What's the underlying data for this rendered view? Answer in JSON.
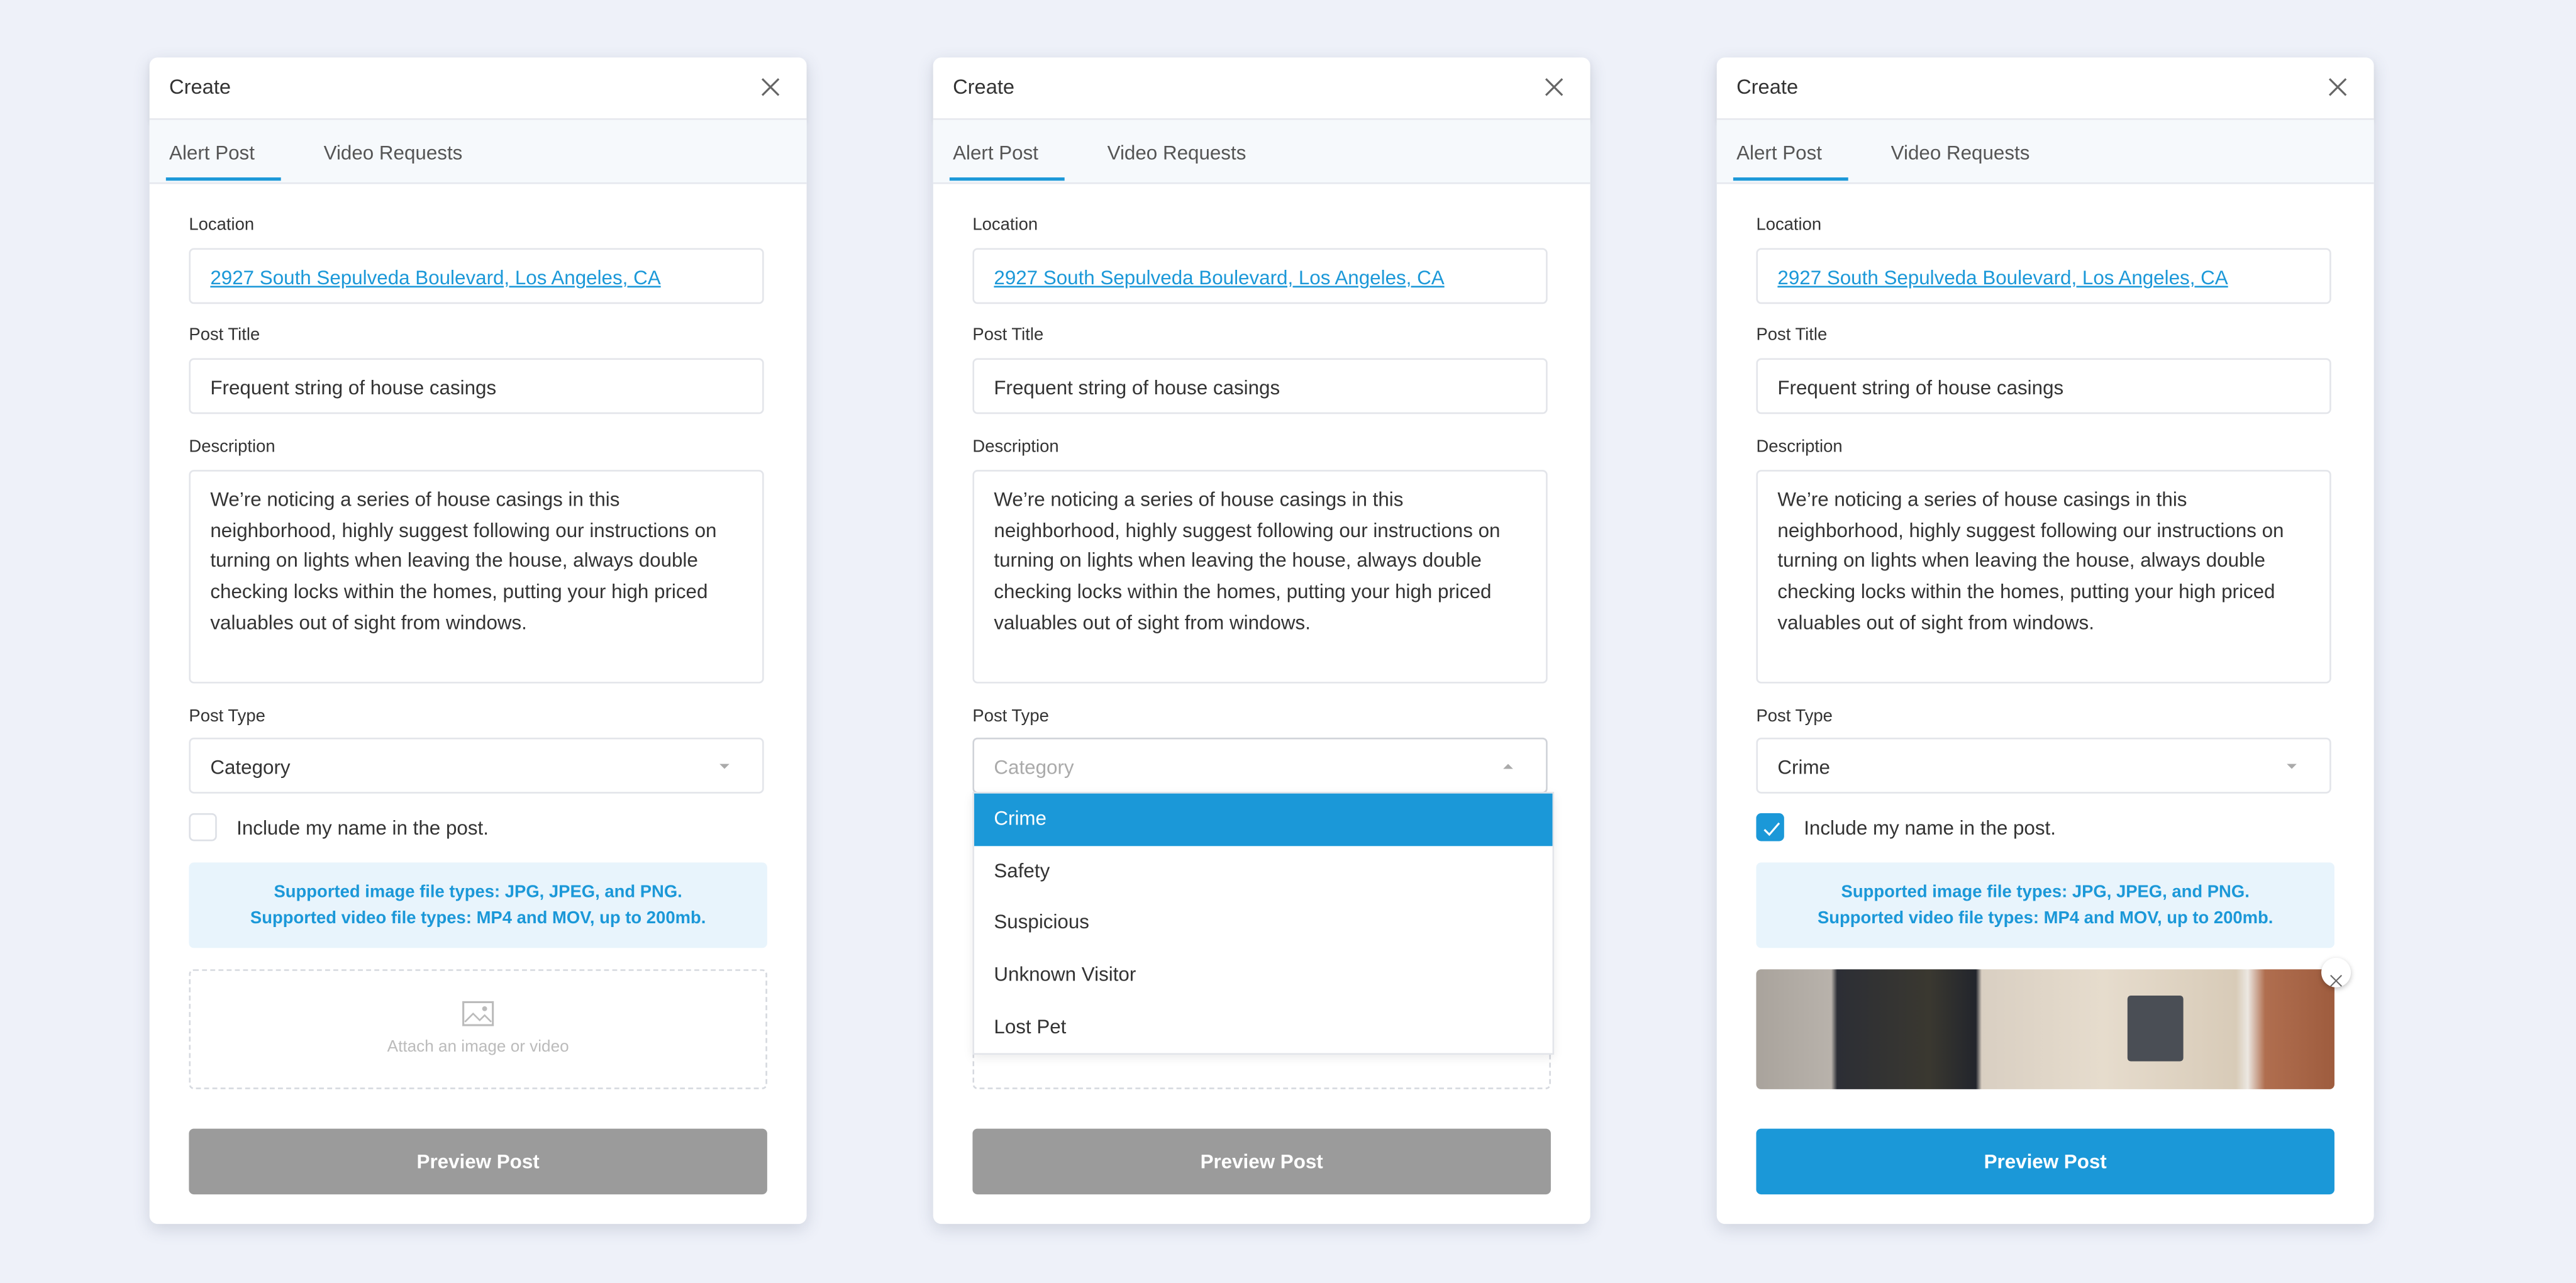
{
  "colors": {
    "accent": "#1b98d8",
    "disabled_button": "#9b9b9b",
    "background": "#eef1f9"
  },
  "dialogs": [
    {
      "title": "Create",
      "tabs": [
        "Alert Post",
        "Video Requests"
      ],
      "location_label": "Location",
      "location": "2927 South Sepulveda Boulevard, Los Angeles, CA",
      "title_label": "Post Title",
      "post_title": "Frequent string of house casings",
      "description_label": "Description",
      "description": "We’re noticing a series of house casings in this neighborhood, highly suggest following our instructions on turning on lights when leaving the house, always double checking locks within the homes, putting your high priced valuables out of sight from windows.",
      "type_label": "Post Type",
      "type_value": "Category",
      "include_name": "Include my name in the post.",
      "include_checked": false,
      "info_line1": "Supported image file types: JPG, JPEG, and PNG.",
      "info_line2": "Supported video file types: MP4 and MOV, up to 200mb.",
      "attach_label": "Attach an image or video",
      "preview": "Preview Post"
    },
    {
      "title": "Create",
      "tabs": [
        "Alert Post",
        "Video Requests"
      ],
      "location_label": "Location",
      "location": "2927 South Sepulveda Boulevard, Los Angeles, CA",
      "title_label": "Post Title",
      "post_title": "Frequent string of house casings",
      "description_label": "Description",
      "description": "We’re noticing a series of house casings in this neighborhood, highly suggest following our instructions on turning on lights when leaving the house, always double checking locks within the homes, putting your high priced valuables out of sight from windows.",
      "type_label": "Post Type",
      "type_placeholder": "Category",
      "options": [
        "Crime",
        "Safety",
        "Suspicious",
        "Unknown Visitor",
        "Lost Pet"
      ],
      "highlighted": "Crime",
      "preview": "Preview Post"
    },
    {
      "title": "Create",
      "tabs": [
        "Alert Post",
        "Video Requests"
      ],
      "location_label": "Location",
      "location": "2927 South Sepulveda Boulevard, Los Angeles, CA",
      "title_label": "Post Title",
      "post_title": "Frequent string of house casings",
      "description_label": "Description",
      "description": "We’re noticing a series of house casings in this neighborhood, highly suggest following our instructions on turning on lights when leaving the house, always double checking locks within the homes, putting your high priced valuables out of sight from windows.",
      "type_label": "Post Type",
      "type_value": "Crime",
      "include_name": "Include my name in the post.",
      "include_checked": true,
      "info_line1": "Supported image file types: JPG, JPEG, and PNG.",
      "info_line2": "Supported video file types: MP4 and MOV, up to 200mb.",
      "preview": "Preview Post"
    }
  ]
}
